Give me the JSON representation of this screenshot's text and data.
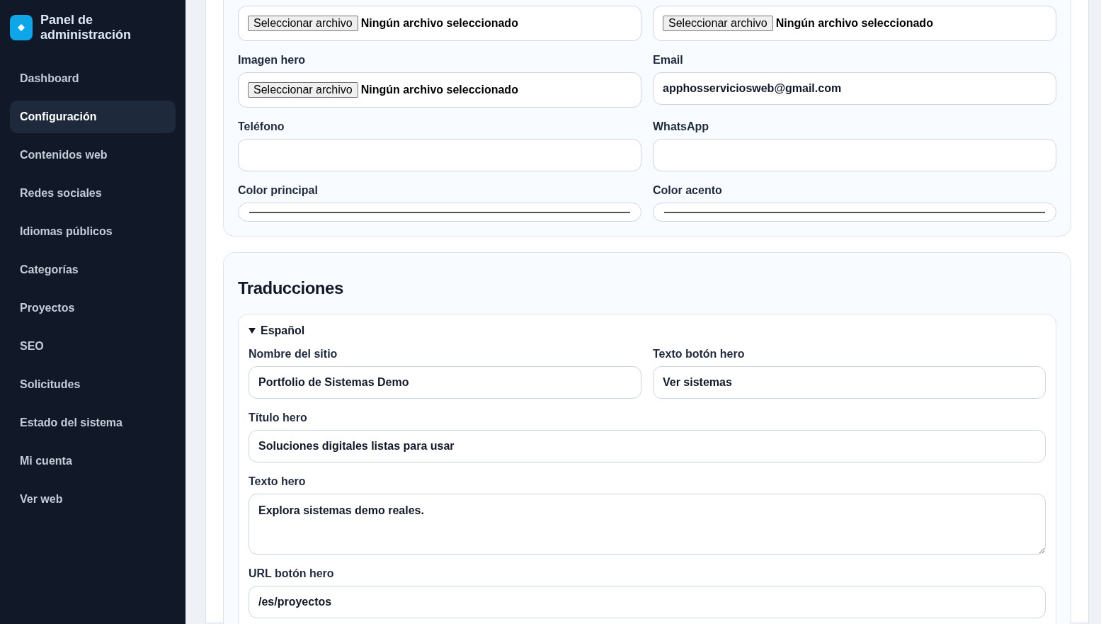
{
  "sidebar": {
    "title": "Panel de administración",
    "items": [
      {
        "label": "Dashboard",
        "selected": false
      },
      {
        "label": "Configuración",
        "selected": true
      },
      {
        "label": "Contenidos web",
        "selected": false
      },
      {
        "label": "Redes sociales",
        "selected": false
      },
      {
        "label": "Idiomas públicos",
        "selected": false
      },
      {
        "label": "Categorías",
        "selected": false
      },
      {
        "label": "Proyectos",
        "selected": false
      },
      {
        "label": "SEO",
        "selected": false
      },
      {
        "label": "Solicitudes",
        "selected": false
      },
      {
        "label": "Estado del sistema",
        "selected": false
      },
      {
        "label": "Mi cuenta",
        "selected": false
      },
      {
        "label": "Ver web",
        "selected": false
      }
    ]
  },
  "settings_card": {
    "fields": [
      {
        "kind": "file",
        "button": "Seleccionar archivo",
        "status": "Ningún archivo seleccionado"
      },
      {
        "kind": "file",
        "button": "Seleccionar archivo",
        "status": "Ningún archivo seleccionado"
      },
      {
        "kind": "file",
        "label": "Imagen hero",
        "button": "Seleccionar archivo",
        "status": "Ningún archivo seleccionado"
      },
      {
        "kind": "text",
        "label": "Email",
        "value": "apphosserviciosweb@gmail.com"
      },
      {
        "kind": "text",
        "label": "Teléfono"
      },
      {
        "kind": "text",
        "label": "WhatsApp"
      },
      {
        "kind": "color",
        "label": "Color principal"
      },
      {
        "kind": "color",
        "label": "Color acento"
      }
    ]
  },
  "translations": {
    "title": "Traducciones",
    "languages": [
      {
        "name": "Español",
        "expanded": true,
        "fields": [
          {
            "kind": "text",
            "label": "Nombre del sitio",
            "value": "Portfolio de Sistemas Demo",
            "wide": false
          },
          {
            "kind": "text",
            "label": "Texto botón hero",
            "value": "Ver sistemas",
            "wide": false
          },
          {
            "kind": "text",
            "label": "Título hero",
            "value": "Soluciones digitales listas para usar",
            "wide": true
          },
          {
            "kind": "textarea",
            "label": "Texto hero",
            "value": "Explora sistemas demo reales.",
            "wide": true
          },
          {
            "kind": "text",
            "label": "URL botón hero",
            "value": "/es/proyectos",
            "wide": true
          }
        ]
      }
    ]
  }
}
